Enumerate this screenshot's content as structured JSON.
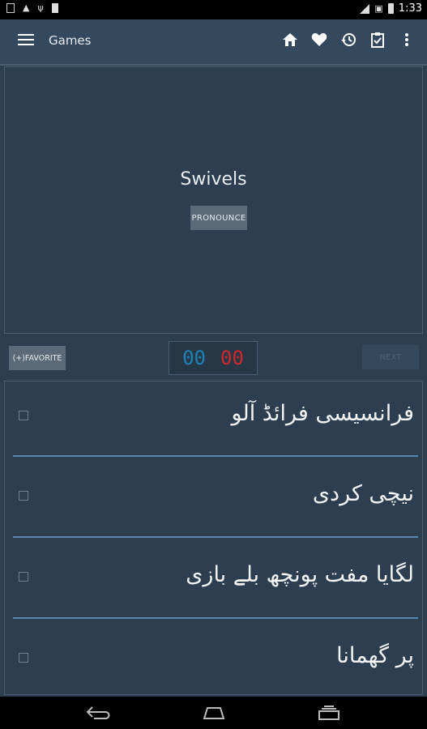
{
  "status_bar": {
    "time": "1:33"
  },
  "app_bar": {
    "title": "Games",
    "icons": [
      "menu-icon",
      "home-icon",
      "heart-icon",
      "history-icon",
      "clipboard-icon",
      "more-icon"
    ]
  },
  "card": {
    "word": "Swivels",
    "pronounce_label": "PRONOUNCE"
  },
  "controls": {
    "favorite_label": "(+)FAVORITE",
    "score_correct": "00",
    "score_wrong": "00",
    "next_label": "NEXT"
  },
  "options": [
    {
      "text": "فرانسیسی فرائڈ آلو",
      "checked": false
    },
    {
      "text": "نیچی کردی",
      "checked": false
    },
    {
      "text": "لگایا مفت پونچھ بلے بازی",
      "checked": false
    },
    {
      "text": "پر گھمانا",
      "checked": false
    }
  ],
  "colors": {
    "background": "#2c3e50",
    "app_bar": "#34495e",
    "score_correct": "#1d82b8",
    "score_wrong": "#d0282d",
    "divider": "#5a86ae"
  }
}
